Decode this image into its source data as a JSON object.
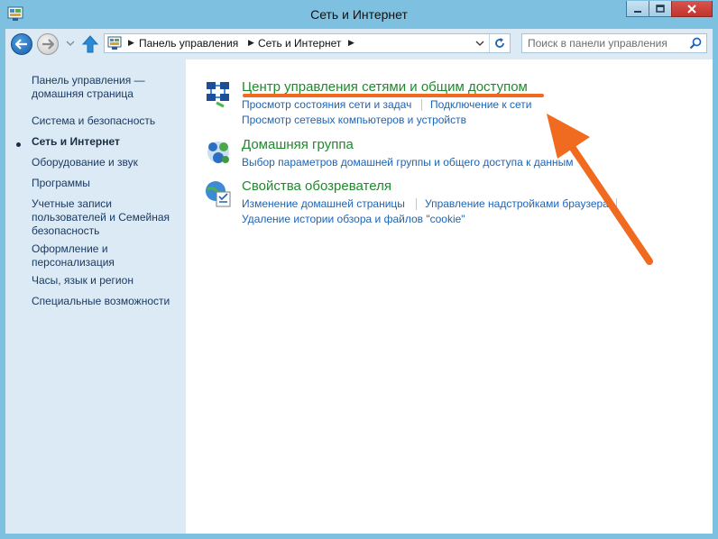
{
  "window": {
    "title": "Сеть и Интернет",
    "accent": "#7ec0e0"
  },
  "navbar": {
    "breadcrumbs": [
      "Панель управления",
      "Сеть и Интернет"
    ],
    "search_placeholder": "Поиск в панели управления"
  },
  "sidebar": {
    "items": [
      {
        "label": "Панель управления — домашняя страница"
      },
      {
        "label": "Система и безопасность"
      },
      {
        "label": "Сеть и Интернет",
        "current": true
      },
      {
        "label": "Оборудование и звук"
      },
      {
        "label": "Программы"
      },
      {
        "label": "Учетные записи пользователей и Семейная безопасность"
      },
      {
        "label": "Оформление и персонализация"
      },
      {
        "label": "Часы, язык и регион"
      },
      {
        "label": "Специальные возможности"
      }
    ]
  },
  "categories": [
    {
      "icon": "network-center-icon",
      "title": "Центр управления сетями и общим доступом",
      "links": [
        "Просмотр состояния сети и задач",
        "Подключение к сети",
        "Просмотр сетевых компьютеров и устройств"
      ]
    },
    {
      "icon": "homegroup-icon",
      "title": "Домашняя группа",
      "links": [
        "Выбор параметров домашней группы и общего доступа к данным"
      ]
    },
    {
      "icon": "internet-options-icon",
      "title": "Свойства обозревателя",
      "links": [
        "Изменение домашней страницы",
        "Управление надстройками браузера",
        "Удаление истории обзора и файлов \"cookie\""
      ]
    }
  ],
  "annotation": {
    "color": "#f06a1f"
  }
}
